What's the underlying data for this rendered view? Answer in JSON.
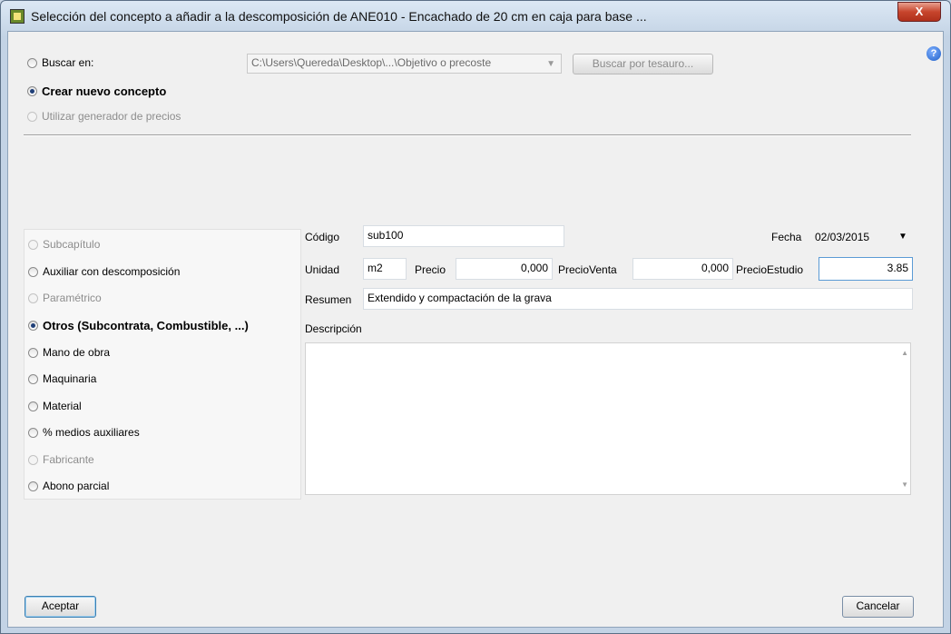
{
  "window": {
    "title": "Selección del concepto a añadir a la descomposición de ANE010 - Encachado de 20 cm en caja para base ...",
    "close_glyph": "X",
    "help_glyph": "?"
  },
  "source": {
    "buscar_label": "Buscar en:",
    "path_value": "C:\\Users\\Quereda\\Desktop\\...\\Objetivo o precoste",
    "tesauro_button": "Buscar por tesauro...",
    "crear_label": "Crear nuevo concepto",
    "generador_label": "Utilizar generador de precios"
  },
  "types": [
    {
      "label": "Subcapítulo",
      "checked": false,
      "disabled": true
    },
    {
      "label": "Auxiliar con descomposición",
      "checked": false,
      "disabled": false
    },
    {
      "label": "Paramétrico",
      "checked": false,
      "disabled": true
    },
    {
      "label": "Otros (Subcontrata, Combustible, ...)",
      "checked": true,
      "disabled": false
    },
    {
      "label": "Mano de obra",
      "checked": false,
      "disabled": false
    },
    {
      "label": "Maquinaria",
      "checked": false,
      "disabled": false
    },
    {
      "label": "Material",
      "checked": false,
      "disabled": false
    },
    {
      "label": "% medios auxiliares",
      "checked": false,
      "disabled": false
    },
    {
      "label": "Fabricante",
      "checked": false,
      "disabled": true
    },
    {
      "label": "Abono parcial",
      "checked": false,
      "disabled": false
    }
  ],
  "form": {
    "codigo_label": "Código",
    "codigo_value": "sub100",
    "fecha_label": "Fecha",
    "fecha_value": "02/03/2015",
    "unidad_label": "Unidad",
    "unidad_value": "m2",
    "precio_label": "Precio",
    "precio_value": "0,000",
    "precioventa_label": "PrecioVenta",
    "precioventa_value": "0,000",
    "precioestudio_label": "PrecioEstudio",
    "precioestudio_value": "3.85",
    "resumen_label": "Resumen",
    "resumen_value": "Extendido y compactación de la grava",
    "descripcion_label": "Descripción",
    "descripcion_value": ""
  },
  "footer": {
    "aceptar": "Aceptar",
    "cancelar": "Cancelar"
  }
}
